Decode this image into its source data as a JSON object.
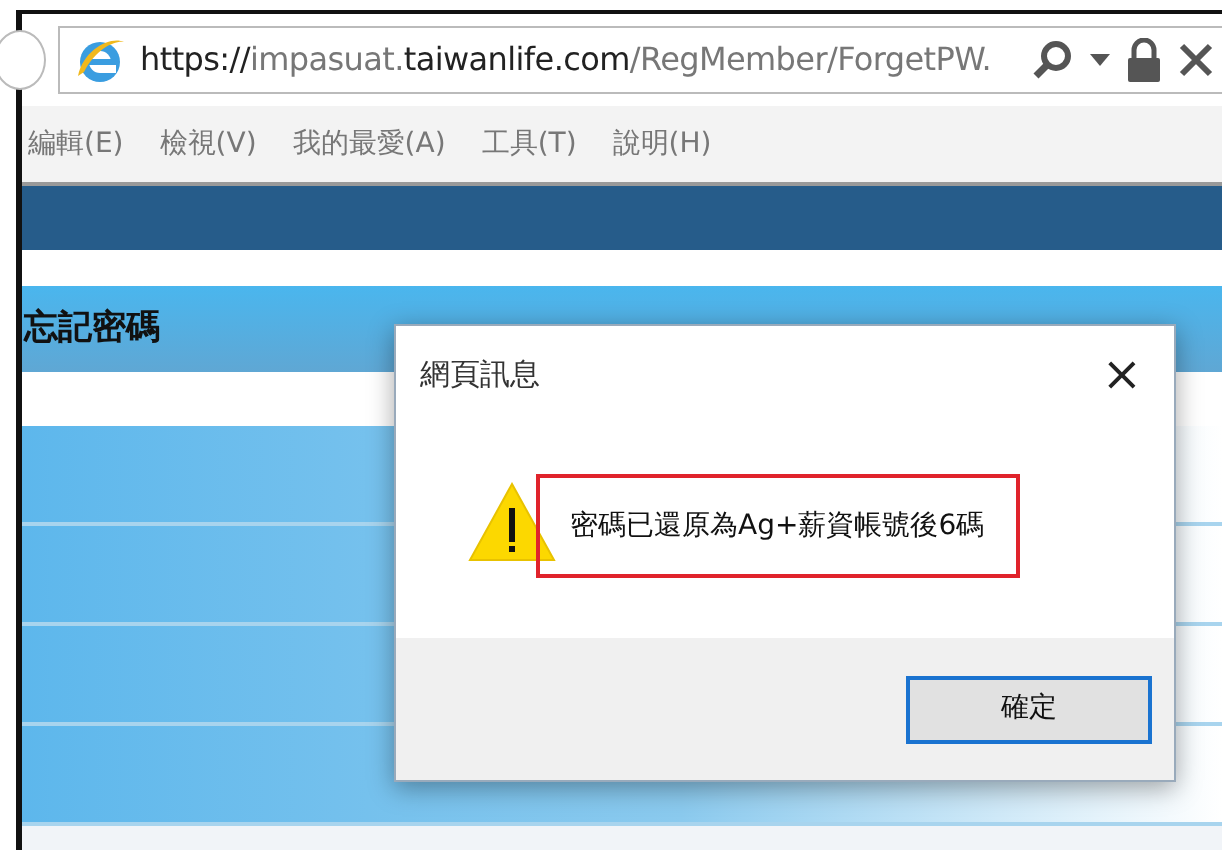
{
  "address_bar": {
    "url_parts": [
      {
        "text": "https://",
        "strong": true
      },
      {
        "text": "impasuat.",
        "strong": false
      },
      {
        "text": "taiwanlife.com",
        "strong": true
      },
      {
        "text": "/RegMember/ForgetPW.",
        "strong": false
      }
    ]
  },
  "menu_bar": {
    "items": [
      "編輯(E)",
      "檢視(V)",
      "我的最愛(A)",
      "工具(T)",
      "說明(H)"
    ]
  },
  "page": {
    "title": "忘記密碼"
  },
  "dialog": {
    "title": "網頁訊息",
    "close": "×",
    "message": "密碼已還原為Ag+薪資帳號後6碼",
    "highlighted": true,
    "button": "確定"
  }
}
